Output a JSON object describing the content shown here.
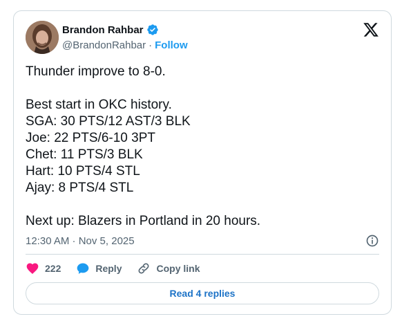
{
  "author": {
    "name": "Brandon Rahbar",
    "handle": "@BrandonRahbar",
    "separator": "·",
    "follow_label": "Follow",
    "verified": true
  },
  "tweet": {
    "text": "Thunder improve to 8-0.\n\nBest start in OKC history.\nSGA: 30 PTS/12 AST/3 BLK\nJoe: 22 PTS/6-10 3PT\nChet: 11 PTS/3 BLK\nHart: 10 PTS/4 STL\nAjay: 8 PTS/4 STL\n\nNext up: Blazers in Portland in 20 hours.",
    "timestamp": "12:30 AM · Nov 5, 2025"
  },
  "actions": {
    "like_count": "222",
    "reply_label": "Reply",
    "copy_link_label": "Copy link"
  },
  "read_replies_label": "Read 4 replies",
  "colors": {
    "accent": "#1d9bf0",
    "like": "#f91880",
    "text": "#0f1419",
    "secondary": "#536471",
    "border": "#cfd9de"
  },
  "icons": [
    "verified-badge-icon",
    "x-logo-icon",
    "info-icon",
    "heart-icon",
    "reply-bubble-icon",
    "link-icon"
  ]
}
